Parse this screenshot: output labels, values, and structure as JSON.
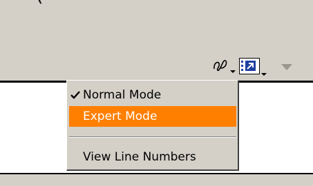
{
  "toolbar": {
    "top_text": "(",
    "buttons": [
      {
        "name": "script-assist",
        "icon": "script-pen-icon"
      },
      {
        "name": "code-outline",
        "icon": "jump-to-icon"
      },
      {
        "name": "panel-options",
        "icon": "triangle-down-icon"
      }
    ]
  },
  "menu": {
    "items": [
      {
        "label": "Normal Mode",
        "checked": true,
        "highlighted": false
      },
      {
        "label": "Expert Mode",
        "checked": false,
        "highlighted": true
      },
      {
        "label": "View Line Numbers",
        "checked": false,
        "highlighted": false
      }
    ]
  },
  "colors": {
    "panel": "#d4d0c8",
    "highlight": "#ff7f00",
    "highlight_text": "#ffffff",
    "disabled_arrow": "#9a978f"
  }
}
